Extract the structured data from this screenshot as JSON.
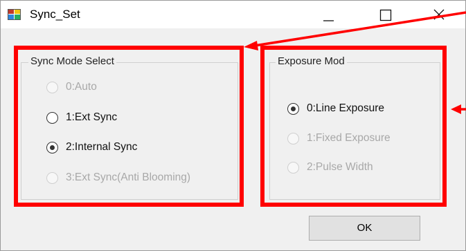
{
  "window": {
    "title": "Sync_Set",
    "controls": [
      "minimize",
      "maximize",
      "close"
    ],
    "icon": "app-window-icon"
  },
  "sync_group": {
    "legend": "Sync Mode Select",
    "options": [
      {
        "label": "0:Auto",
        "checked": false,
        "enabled": false
      },
      {
        "label": "1:Ext Sync",
        "checked": false,
        "enabled": true
      },
      {
        "label": "2:Internal Sync",
        "checked": true,
        "enabled": true
      },
      {
        "label": "3:Ext Sync(Anti Blooming)",
        "checked": false,
        "enabled": false
      }
    ]
  },
  "exposure_group": {
    "legend": "Exposure Mod",
    "options": [
      {
        "label": "0:Line Exposure",
        "checked": true,
        "enabled": true
      },
      {
        "label": "1:Fixed Exposure",
        "checked": false,
        "enabled": false
      },
      {
        "label": "2:Pulse Width",
        "checked": false,
        "enabled": false
      }
    ]
  },
  "ok_button": {
    "label": "OK"
  },
  "annotation": {
    "color": "#ff0000"
  }
}
